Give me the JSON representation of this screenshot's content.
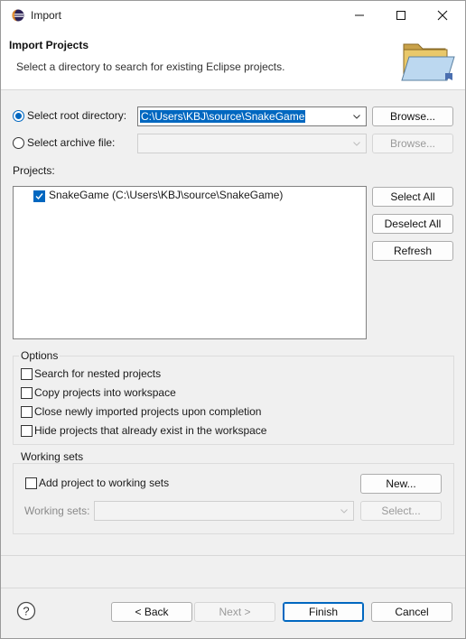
{
  "window": {
    "title": "Import"
  },
  "banner": {
    "title": "Import Projects",
    "description": "Select a directory to search for existing Eclipse projects."
  },
  "source": {
    "root_dir_label": "Select root directory:",
    "root_dir_value": "C:\\Users\\KBJ\\source\\SnakeGame",
    "root_dir_selected": true,
    "archive_label": "Select archive file:",
    "archive_value": "",
    "browse_label": "Browse...",
    "browse_archive_label": "Browse..."
  },
  "projects": {
    "label": "Projects:",
    "items": [
      {
        "name": "SnakeGame (C:\\Users\\KBJ\\source\\SnakeGame)",
        "checked": true
      }
    ],
    "select_all": "Select All",
    "deselect_all": "Deselect All",
    "refresh": "Refresh"
  },
  "options": {
    "title": "Options",
    "items": [
      {
        "label": "Search for nested projects",
        "checked": false
      },
      {
        "label": "Copy projects into workspace",
        "checked": false
      },
      {
        "label": "Close newly imported projects upon completion",
        "checked": false
      },
      {
        "label": "Hide projects that already exist in the workspace",
        "checked": false
      }
    ]
  },
  "working_sets": {
    "title": "Working sets",
    "add_label": "Add project to working sets",
    "add_checked": false,
    "new_label": "New...",
    "sets_label": "Working sets:",
    "sets_value": "",
    "select_label": "Select..."
  },
  "footer": {
    "back": "< Back",
    "next": "Next >",
    "finish": "Finish",
    "cancel": "Cancel"
  },
  "colors": {
    "accent": "#0067c0",
    "dialog_bg": "#f0f0f0"
  }
}
